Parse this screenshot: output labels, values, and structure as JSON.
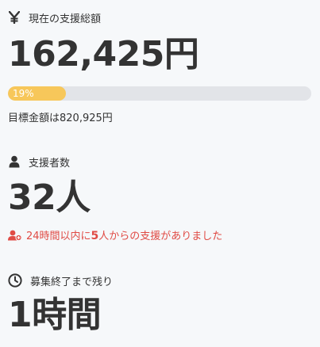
{
  "funding": {
    "label": "現在の支援総額",
    "amount": "162,425円",
    "progress_percent": 19,
    "progress_label": "19%",
    "goal_text": "目標金額は820,925円"
  },
  "supporters": {
    "label": "支援者数",
    "count": "32人",
    "recent_prefix": "24時間以内に",
    "recent_number": "5",
    "recent_suffix": "人からの支援がありました"
  },
  "remaining": {
    "label": "募集終了まで残り",
    "time": "1時間"
  },
  "colors": {
    "progress_fill": "#f7c75a",
    "progress_track": "#e2e4e8",
    "alert": "#e04b45",
    "text": "#333333"
  },
  "icons": {
    "funding": "yen-icon",
    "supporters": "person-icon",
    "recent": "user-plus-icon",
    "remaining": "clock-icon"
  }
}
